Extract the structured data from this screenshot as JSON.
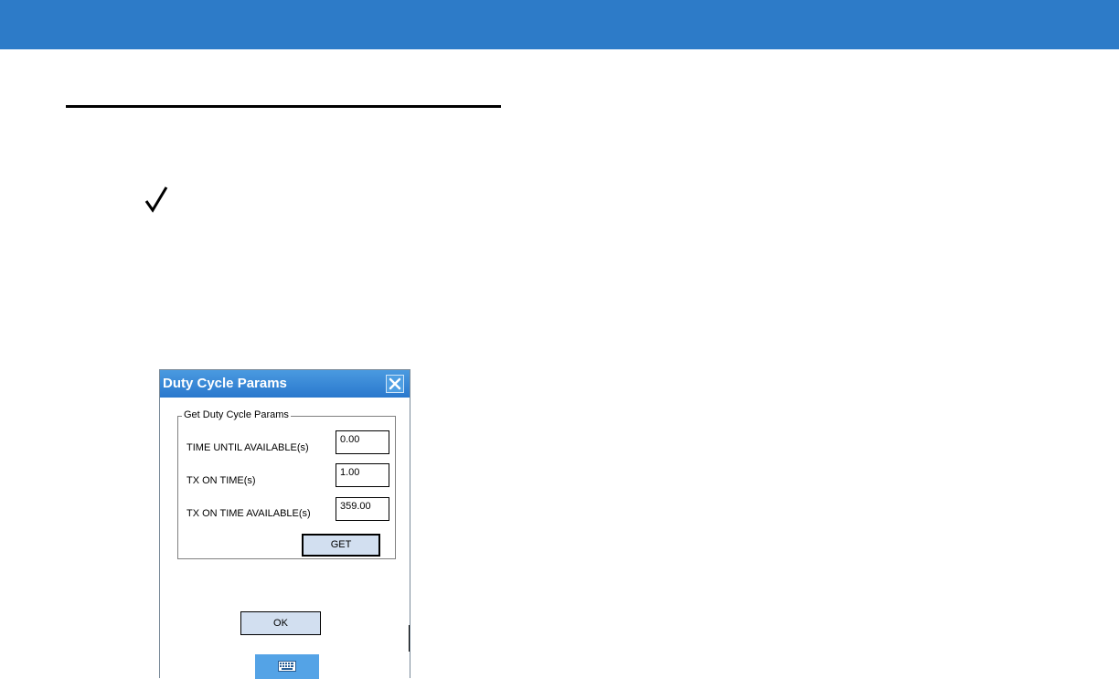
{
  "dialog": {
    "title": "Duty Cycle Params",
    "group_label": "Get Duty Cycle Params",
    "fields": [
      {
        "label": "TIME UNTIL AVAILABLE(s)",
        "value": "0.00"
      },
      {
        "label": "TX ON TIME(s)",
        "value": "1.00"
      },
      {
        "label": "TX ON TIME AVAILABLE(s)",
        "value": "359.00"
      }
    ],
    "get_button": "GET",
    "ok_button": "OK"
  },
  "icons": {
    "note": "check-mark-icon",
    "close": "close-icon",
    "keyboard": "keyboard-icon"
  },
  "colors": {
    "header_bar": "#2d7bc8",
    "title_bar": "#3a89d6",
    "button_fill": "#d2dff0"
  }
}
